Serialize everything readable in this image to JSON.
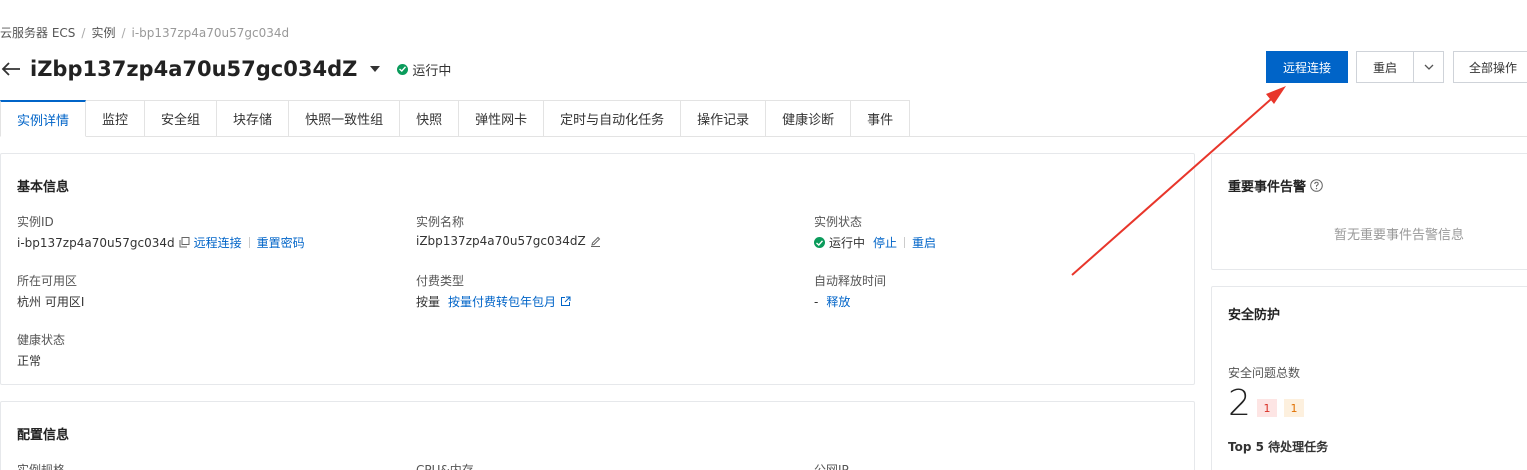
{
  "breadcrumb": {
    "item1": "云服务器 ECS",
    "item2": "实例",
    "item3": "i-bp137zp4a70u57gc034d"
  },
  "header": {
    "title": "iZbp137zp4a70u57gc034dZ",
    "status": "运行中"
  },
  "actions": {
    "remote": "远程连接",
    "restart": "重启",
    "all": "全部操作"
  },
  "tabs": [
    "实例详情",
    "监控",
    "安全组",
    "块存储",
    "快照一致性组",
    "快照",
    "弹性网卡",
    "定时与自动化任务",
    "操作记录",
    "健康诊断",
    "事件"
  ],
  "basic": {
    "title": "基本信息",
    "instance_id_label": "实例ID",
    "instance_id": "i-bp137zp4a70u57gc034d",
    "remote_link": "远程连接",
    "reset_pwd_link": "重置密码",
    "instance_name_label": "实例名称",
    "instance_name": "iZbp137zp4a70u57gc034dZ",
    "instance_status_label": "实例状态",
    "instance_status": "运行中",
    "stop_link": "停止",
    "restart_link": "重启",
    "zone_label": "所在可用区",
    "zone": "杭州 可用区I",
    "billing_label": "付费类型",
    "billing": "按量",
    "billing_link": "按量付费转包年包月",
    "release_label": "自动释放时间",
    "release": "-",
    "release_link": "释放",
    "health_label": "健康状态",
    "health": "正常"
  },
  "config": {
    "title": "配置信息",
    "spec_label": "实例规格",
    "cpu_label": "CPU&内存",
    "ip_label": "公网IP"
  },
  "events": {
    "title": "重要事件告警",
    "empty": "暂无重要事件告警信息"
  },
  "security": {
    "title": "安全防护",
    "total_label": "安全问题总数",
    "total": "2",
    "badge_red": "1",
    "badge_orange": "1",
    "top5_label": "Top 5 待处理任务"
  },
  "colors": {
    "primary": "#0064c8",
    "success": "#0a9b5b",
    "arrow": "#e8362b"
  }
}
